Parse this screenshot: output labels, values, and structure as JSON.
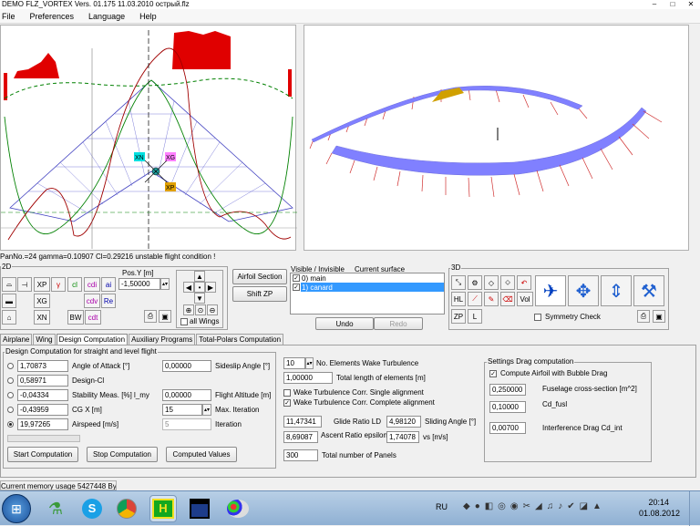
{
  "window": {
    "title": "DEMO  FLZ_VORTEX   Vers. 01.175 11.03.2010 острый.flz",
    "min": "–",
    "max": "□",
    "close": "✕"
  },
  "menu": [
    "File",
    "Preferences",
    "Language",
    "Help"
  ],
  "status_line": "PanNo.=24 gamma=0.10907 Cl=0.29216    unstable flight condition !",
  "markers": {
    "xn": "XN",
    "xg": "XG",
    "xp": "XP"
  },
  "toolbar2d": {
    "label": "2D",
    "buttons": [
      "XP",
      "cl",
      "cdi",
      "ai",
      "XG",
      "cdv",
      "Re",
      "XN",
      "BW",
      "cdt"
    ],
    "pos_y_label": "Pos.Y [m]",
    "pos_y_value": "-1,50000",
    "all_wings": "all Wings"
  },
  "airfoil_section_button": "Airfoil Section",
  "shift_zp_button": "Shift ZP",
  "surfaces": {
    "header_visible": "Visible / Invisible",
    "header_current": "Current surface",
    "items": [
      "0) main",
      "1) canard"
    ],
    "undo": "Undo",
    "redo": "Redo"
  },
  "toolbar3d": {
    "label": "3D",
    "buttons": [
      "HL",
      "ZP",
      "L",
      "Vol"
    ],
    "symmetry_check": "Symmetry Check"
  },
  "tabs": [
    "Airplane",
    "Wing",
    "Design Computation",
    "Auxiliary Programs",
    "Total-Polars Computation"
  ],
  "active_tab": "Design Computation",
  "design": {
    "group_title": "Design Computation for straight and level flight",
    "rows": [
      {
        "value": "1,70873",
        "label": "Angle of Attack [°]"
      },
      {
        "value": "0,58971",
        "label": "Design-Cl"
      },
      {
        "value": "-0,04334",
        "label": "Stability Meas. [%] l_my"
      },
      {
        "value": "-0,43959",
        "label": "CG X [m]"
      },
      {
        "value": "19,97265",
        "label": "Airspeed [m/s]"
      }
    ],
    "selected_row": 4,
    "right_rows": [
      {
        "value": "0,00000",
        "label": "Sideslip Angle [°]"
      },
      {
        "value": "0,00000",
        "label": "Flight Altitude [m]"
      },
      {
        "value": "15",
        "label": "Max. Iteration"
      },
      {
        "value": "5",
        "label": "Iteration"
      }
    ],
    "start": "Start Computation",
    "stop": "Stop Computation",
    "computed": "Computed Values"
  },
  "wake": {
    "elements_value": "10",
    "elements_label": "No. Elements Wake Turbulence",
    "length_value": "1,00000",
    "length_label": "Total length of elements [m]",
    "single": "Wake Turbulence Corr. Single alignment",
    "complete": "Wake Turbulence Corr. Complete alignment",
    "glide_value": "11,47341",
    "glide_label": "Glide Ratio LD",
    "sliding_value": "4,98120",
    "sliding_label": "Sliding Angle [°]",
    "ascent_value": "8,69087",
    "ascent_label": "Ascent Ratio epsilon",
    "vs_value": "1,74078",
    "vs_label": "vs [m/s]",
    "panels_value": "300",
    "panels_label": "Total number of Panels"
  },
  "drag": {
    "group_title": "Settings Drag computation",
    "bubble": "Compute Airfoil with Bubble Drag",
    "fuselage_value": "0,250000",
    "fuselage_label": "Fuselage cross-section [m^2]",
    "cdfusl_value": "0,10000",
    "cdfusl_label": "Cd_fusl",
    "interf_value": "0,00700",
    "interf_label": "Interference Drag Cd_int"
  },
  "memory": "Current memory usage 5427448 Byte",
  "taskbar": {
    "lang": "RU",
    "time": "20:14",
    "date": "01.08.2012",
    "start_icon": "windows-orb-icon",
    "app_icons": [
      "chrome-icon",
      "flz-icon",
      "save-icon",
      "paint-icon"
    ]
  },
  "colors": {
    "window_bg": "#f0f0f0",
    "selection": "#3399ff",
    "pressure_red": "#e00000",
    "wing_blue": "#8080ff",
    "mesh_blue": "#4040c0",
    "curve_green": "#008000",
    "curve_darkred": "#a00000"
  }
}
